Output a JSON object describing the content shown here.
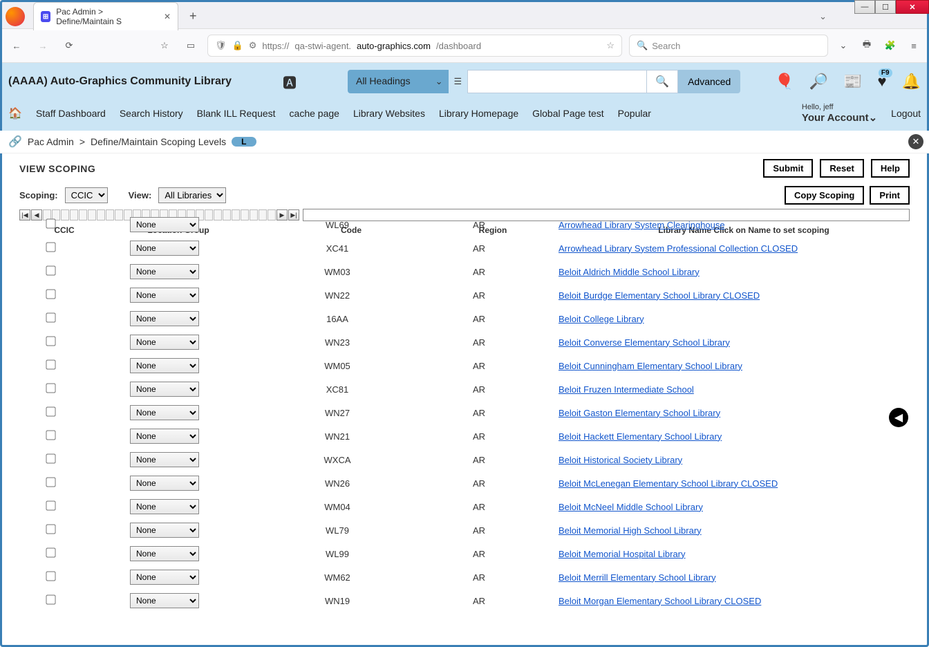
{
  "window": {
    "tab_title": "Pac Admin > Define/Maintain S",
    "tab_plus": "+"
  },
  "url": {
    "scheme": "https://",
    "sub": "qa-stwi-agent.",
    "host": "auto-graphics.com",
    "path": "/dashboard",
    "search_placeholder": "Search"
  },
  "app": {
    "org": "(AAAA) Auto-Graphics Community Library",
    "heading_select": "All Headings",
    "advanced": "Advanced",
    "badge": "F9"
  },
  "nav": [
    "Staff Dashboard",
    "Search History",
    "Blank ILL Request",
    "cache page",
    "Library Websites",
    "Library Homepage",
    "Global Page test",
    "Popular"
  ],
  "account": {
    "hello": "Hello, jeff",
    "your_account": "Your Account",
    "logout": "Logout"
  },
  "breadcrumb": {
    "a": "Pac Admin",
    "b": "Define/Maintain Scoping Levels",
    "badge": "L"
  },
  "scoping": {
    "title": "VIEW SCOPING",
    "submit": "Submit",
    "reset": "Reset",
    "help": "Help",
    "copy": "Copy Scoping",
    "print": "Print",
    "scoping_label": "Scoping:",
    "scoping_value": "CCIC",
    "view_label": "View:",
    "view_value": "All Libraries"
  },
  "columns": {
    "c1": "CCIC",
    "c2": "Location Group",
    "c3": "Code",
    "c4": "Region",
    "c5": "Library Name Click on Name to set scoping"
  },
  "loc_option": "None",
  "rows": [
    {
      "code": "WL69",
      "region": "AR",
      "name": "Arrowhead Library System Clearinghouse"
    },
    {
      "code": "XC41",
      "region": "AR",
      "name": "Arrowhead Library System Professional Collection CLOSED"
    },
    {
      "code": "WM03",
      "region": "AR",
      "name": "Beloit Aldrich Middle School Library"
    },
    {
      "code": "WN22",
      "region": "AR",
      "name": "Beloit Burdge Elementary School Library CLOSED"
    },
    {
      "code": "16AA",
      "region": "AR",
      "name": "Beloit College Library"
    },
    {
      "code": "WN23",
      "region": "AR",
      "name": "Beloit Converse Elementary School Library"
    },
    {
      "code": "WM05",
      "region": "AR",
      "name": "Beloit Cunningham Elementary School Library"
    },
    {
      "code": "XC81",
      "region": "AR",
      "name": "Beloit Fruzen Intermediate School"
    },
    {
      "code": "WN27",
      "region": "AR",
      "name": "Beloit Gaston Elementary School Library"
    },
    {
      "code": "WN21",
      "region": "AR",
      "name": "Beloit Hackett Elementary School Library"
    },
    {
      "code": "WXCA",
      "region": "AR",
      "name": "Beloit Historical Society Library"
    },
    {
      "code": "WN26",
      "region": "AR",
      "name": "Beloit McLenegan Elementary School Library CLOSED"
    },
    {
      "code": "WM04",
      "region": "AR",
      "name": "Beloit McNeel Middle School Library"
    },
    {
      "code": "WL79",
      "region": "AR",
      "name": "Beloit Memorial High School Library"
    },
    {
      "code": "WL99",
      "region": "AR",
      "name": "Beloit Memorial Hospital Library"
    },
    {
      "code": "WM62",
      "region": "AR",
      "name": "Beloit Merrill Elementary School Library"
    },
    {
      "code": "WN19",
      "region": "AR",
      "name": "Beloit Morgan Elementary School Library CLOSED"
    }
  ]
}
